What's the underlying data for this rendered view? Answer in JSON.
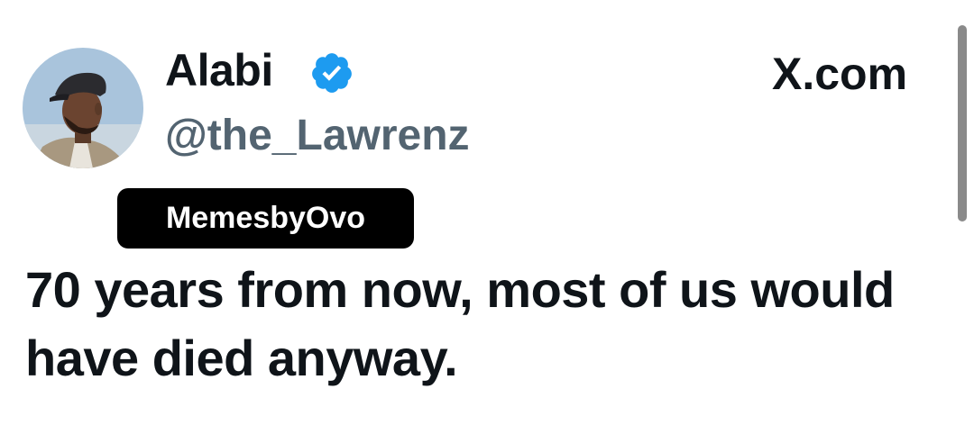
{
  "tweet": {
    "author": {
      "display_name": "Alabi",
      "handle": "@the_Lawrenz",
      "verified": true,
      "verified_badge_color": "#1d9bf0"
    },
    "site_label": "X.com",
    "watermark": "MemesbyOvo",
    "text": "70 years from now, most of us would have died anyway."
  },
  "colors": {
    "text": "#0f1419",
    "handle": "#536471",
    "background": "#ffffff",
    "watermark_bg": "#000000",
    "scrollbar": "#8a8a8a"
  },
  "icons": {
    "verified": "verified-badge-icon",
    "avatar": "profile-photo"
  }
}
